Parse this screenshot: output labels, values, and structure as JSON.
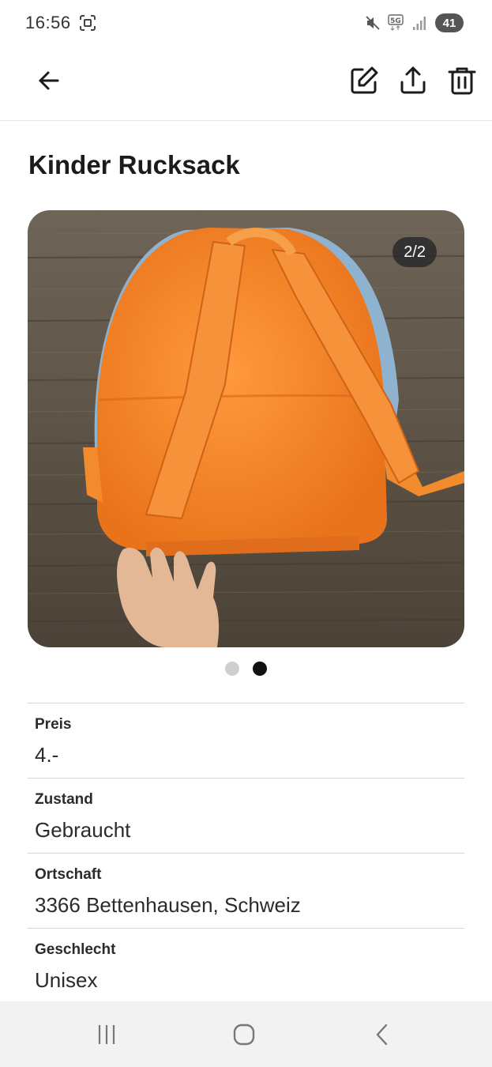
{
  "status_bar": {
    "time": "16:56",
    "network": "5G",
    "battery": "41",
    "icons": [
      "screenshot-icon",
      "mute-icon",
      "network-5g-icon",
      "signal-icon",
      "battery-icon"
    ]
  },
  "app_bar": {
    "icons": [
      "arrow-left-icon",
      "edit-icon",
      "share-icon",
      "trash-icon"
    ]
  },
  "listing": {
    "title": "Kinder Rucksack",
    "image_counter": "2/2",
    "current_image": 2,
    "image_count": 2
  },
  "details": [
    {
      "label": "Preis",
      "value": "4.-"
    },
    {
      "label": "Zustand",
      "value": "Gebraucht"
    },
    {
      "label": "Ortschaft",
      "value": "3366 Bettenhausen, Schweiz"
    },
    {
      "label": "Geschlecht",
      "value": "Unisex"
    }
  ],
  "nav_bar": {
    "icons": [
      "recents-icon",
      "home-icon",
      "back-icon"
    ]
  },
  "colors": {
    "background": "#ffffff",
    "text": "#1b1b1b",
    "divider": "#d6d6d6",
    "nav_background": "#f2f2f2",
    "dot_active": "#111111",
    "dot_inactive": "#cfcfcf"
  }
}
